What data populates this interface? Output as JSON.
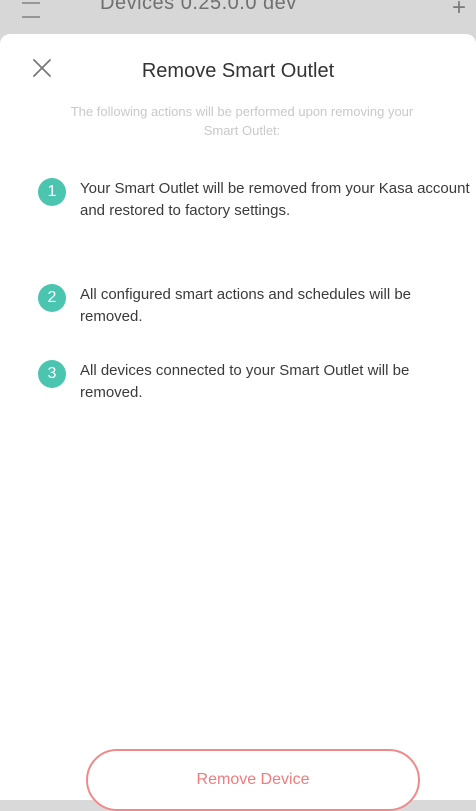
{
  "background": {
    "title": "Devices 0.25.0.0  dev",
    "menu_icon": "menu-icon",
    "add_icon": "plus-icon"
  },
  "dialog": {
    "close_icon": "close-icon",
    "title": "Remove Smart Outlet",
    "subtitle": "The following actions will be performed upon removing your Smart Outlet:",
    "items": [
      {
        "number": "1",
        "text": "Your Smart Outlet will be removed from your Kasa account and restored to factory settings."
      },
      {
        "number": "2",
        "text": "All configured smart actions and schedules will be removed."
      },
      {
        "number": "3",
        "text": "All devices connected to your Smart Outlet will be removed."
      }
    ],
    "remove_button_label": "Remove Device"
  },
  "colors": {
    "accent_teal": "#4cc5b0",
    "danger": "#f07b7b"
  }
}
